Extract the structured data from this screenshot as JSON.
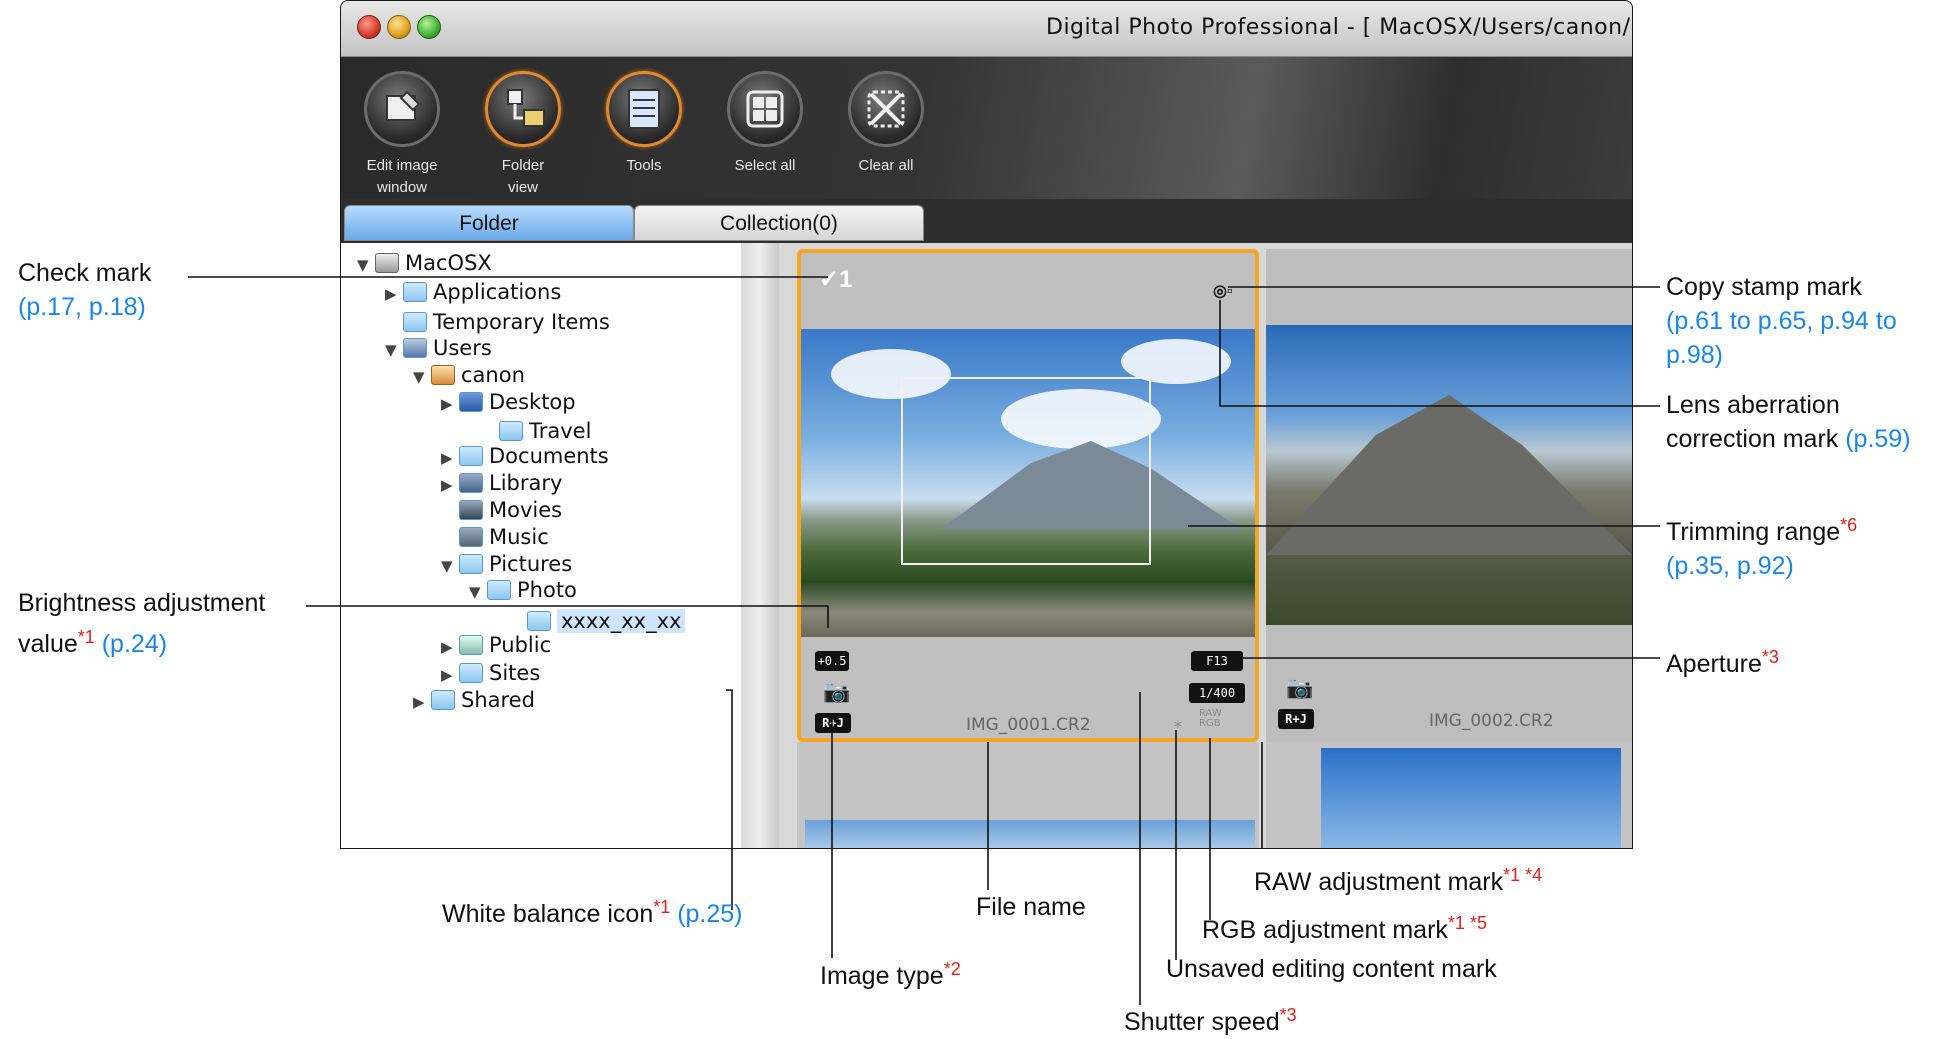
{
  "window": {
    "title": "Digital Photo Professional - [ MacOSX/Users/canon/"
  },
  "toolbar": {
    "buttons": [
      {
        "label_1": "Edit image",
        "label_2": "window",
        "icon": "edit-window-icon"
      },
      {
        "label_1": "Folder",
        "label_2": "view",
        "icon": "folder-view-icon"
      },
      {
        "label_1": "Tools",
        "label_2": "",
        "icon": "tools-icon"
      },
      {
        "label_1": "Select all",
        "label_2": "",
        "icon": "select-all-icon"
      },
      {
        "label_1": "Clear all",
        "label_2": "",
        "icon": "clear-all-icon"
      }
    ]
  },
  "tabs": {
    "folder": "Folder",
    "collection": "Collection(0)"
  },
  "tree": {
    "items": [
      {
        "label": "MacOSX"
      },
      {
        "label": "Applications"
      },
      {
        "label": "Temporary Items"
      },
      {
        "label": "Users"
      },
      {
        "label": "canon"
      },
      {
        "label": "Desktop"
      },
      {
        "label": "Travel"
      },
      {
        "label": "Documents"
      },
      {
        "label": "Library"
      },
      {
        "label": "Movies"
      },
      {
        "label": "Music"
      },
      {
        "label": "Pictures"
      },
      {
        "label": "Photo"
      },
      {
        "label": "xxxx_xx_xx"
      },
      {
        "label": "Public"
      },
      {
        "label": "Sites"
      },
      {
        "label": "Shared"
      }
    ]
  },
  "thumbs": [
    {
      "filename": "IMG_0001.CR2",
      "brightness": "+0.5",
      "aperture": "F13",
      "shutter": "1/400",
      "type": "R+J",
      "raw_rgb": "RAW RGB",
      "unsaved": "*"
    },
    {
      "filename": "IMG_0002.CR2",
      "type": "R+J"
    }
  ],
  "callouts": {
    "check_mark": {
      "text": "Check mark",
      "ref": "(p.17, p.18)"
    },
    "copy_stamp": {
      "text": "Copy stamp mark",
      "ref_1": "(p.61 to p.65, p.94 to",
      "ref_2": "p.98)"
    },
    "lens_aberration": {
      "text_1": "Lens aberration",
      "text_2": "correction mark",
      "ref": "(p.59)"
    },
    "trimming": {
      "text": "Trimming range",
      "star": "*6",
      "ref": "(p.35, p.92)"
    },
    "brightness": {
      "text_1": "Brightness adjustment",
      "text_2": "value",
      "star": "*1",
      "ref": "(p.24)"
    },
    "aperture": {
      "text": "Aperture",
      "star": "*3"
    },
    "white_balance": {
      "text": "White balance icon",
      "star": "*1",
      "ref": "(p.25)"
    },
    "file_name": {
      "text": "File name"
    },
    "raw_adjust": {
      "text": "RAW adjustment mark",
      "star": "*1 *4"
    },
    "rgb_adjust": {
      "text": "RGB adjustment mark",
      "star": "*1 *5"
    },
    "image_type": {
      "text": "Image type",
      "star": "*2"
    },
    "unsaved": {
      "text": "Unsaved editing content mark"
    },
    "shutter": {
      "text": "Shutter speed",
      "star": "*3"
    }
  },
  "colors": {
    "reference_blue": "#1a86e8",
    "footnote_red": "#e0201a",
    "selection_orange": "#f5a623"
  }
}
